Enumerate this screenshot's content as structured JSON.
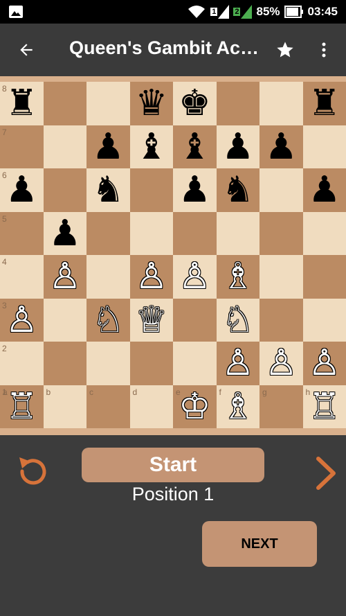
{
  "status_bar": {
    "battery_percent": "85%",
    "time": "03:45",
    "sim1_label": "1",
    "sim2_label": "2"
  },
  "app_bar": {
    "title": "Queen's Gambit Acc…"
  },
  "board": {
    "files": [
      "a",
      "b",
      "c",
      "d",
      "e",
      "f",
      "g",
      "h"
    ],
    "ranks": [
      "8",
      "7",
      "6",
      "5",
      "4",
      "3",
      "2",
      "1"
    ],
    "squares": [
      [
        "♜",
        "",
        "",
        "♛",
        "♚",
        "",
        "",
        "♜"
      ],
      [
        "",
        "",
        "♟",
        "♝",
        "♝",
        "♟",
        "♟",
        ""
      ],
      [
        "♟",
        "",
        "♞",
        "",
        "♟",
        "♞",
        "",
        "♟"
      ],
      [
        "",
        "♟",
        "",
        "",
        "",
        "",
        "",
        ""
      ],
      [
        "",
        "♙",
        "",
        "♙",
        "♙",
        "♗",
        "",
        ""
      ],
      [
        "♙",
        "",
        "♘",
        "♕",
        "",
        "♘",
        "",
        ""
      ],
      [
        "",
        "",
        "",
        "",
        "",
        "♙",
        "♙",
        "♙"
      ],
      [
        "♖",
        "",
        "",
        "",
        "♔",
        "♗",
        "",
        "♖"
      ]
    ],
    "light_color": "#f0dcbf",
    "dark_color": "#bb8b63"
  },
  "controls": {
    "start_label": "Start",
    "position_label": "Position 1",
    "next_label": "NEXT",
    "accent_color": "#c49474",
    "arrow_color": "#d7733a"
  }
}
